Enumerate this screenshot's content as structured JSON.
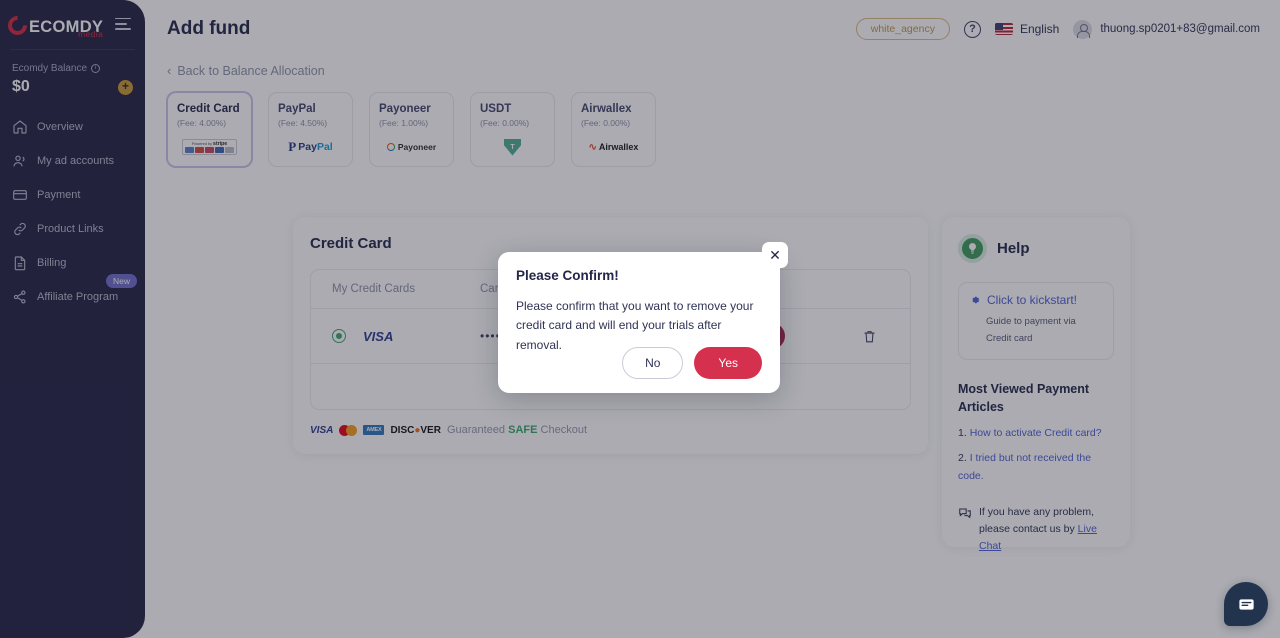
{
  "sidebar": {
    "logo_word": "ECOMDY",
    "logo_sub": "media",
    "balance_label": "Ecomdy Balance",
    "balance_amount": "$0",
    "add_funds_symbol": "+",
    "items": [
      {
        "label": "Overview",
        "icon": "home-icon"
      },
      {
        "label": "My ad accounts",
        "icon": "users-icon"
      },
      {
        "label": "Payment",
        "icon": "credit-card-icon"
      },
      {
        "label": "Product Links",
        "icon": "link-icon"
      },
      {
        "label": "Billing",
        "icon": "document-icon"
      },
      {
        "label": "Affiliate Program",
        "icon": "share-icon",
        "badge": "New"
      }
    ]
  },
  "header": {
    "title": "Add fund",
    "agency_label": "white_agency",
    "help_icon": "question-mark-icon",
    "language": "English",
    "flag": "us-flag-icon",
    "user_email": "thuong.sp0201+83@gmail.com"
  },
  "back_link": {
    "label": "Back to Balance Allocation",
    "icon": "chevron-left-icon"
  },
  "payment_methods": [
    {
      "name": "Credit Card",
      "fee": "(Fee: 4.00%)",
      "logo": "stripe-logo",
      "active": true
    },
    {
      "name": "PayPal",
      "fee": "(Fee: 4.50%)",
      "logo": "paypal-logo",
      "active": false
    },
    {
      "name": "Payoneer",
      "fee": "(Fee: 1.00%)",
      "logo": "payoneer-logo",
      "active": false
    },
    {
      "name": "USDT",
      "fee": "(Fee: 0.00%)",
      "logo": "tether-logo",
      "active": false
    },
    {
      "name": "Airwallex",
      "fee": "(Fee: 0.00%)",
      "logo": "airwallex-logo",
      "active": false
    }
  ],
  "stripe_badge": {
    "powered": "Powered by",
    "brand": "stripe"
  },
  "credit_card_panel": {
    "title": "Credit Card",
    "columns": [
      "My Credit Cards",
      "Card Number",
      "",
      ""
    ],
    "rows": [
      {
        "selected": true,
        "brand": "VISA",
        "masked_number": "••••",
        "action_label": "Set as default",
        "delete_icon": "trash-icon"
      }
    ],
    "add_card_label": "Add credit card",
    "add_card_icon": "plus-icon",
    "secure_text_pre": "Guaranteed",
    "secure_text_safe": "SAFE",
    "secure_text_post": "Checkout",
    "card_brands": [
      "VISA",
      "MasterCard",
      "AMEX",
      "DISCOVER"
    ]
  },
  "help_panel": {
    "title": "Help",
    "bulb_icon": "lightbulb-icon",
    "kickstart_link": "Click to kickstart!",
    "kickstart_icon": "gear-icon",
    "kickstart_sub": "Guide to payment via Credit card",
    "articles_title": "Most Viewed Payment Articles",
    "articles": [
      {
        "num": "1.",
        "text": "How to activate Credit card?"
      },
      {
        "num": "2.",
        "text": "I tried but not received the code."
      }
    ],
    "contact_icon": "chat-icon",
    "contact_text": "If you have any problem, please contact us by",
    "contact_link": "Live Chat"
  },
  "modal": {
    "title": "Please Confirm!",
    "body": "Please confirm that you want to remove your credit card and will end your trials after removal.",
    "close_icon": "close-icon",
    "no_label": "No",
    "yes_label": "Yes"
  },
  "chat_fab": {
    "icon": "message-icon"
  },
  "colors": {
    "sidebar_bg": "#222244",
    "brand_red": "#d6283f",
    "accent_gold": "#c99a36",
    "danger": "#d6304f",
    "link_blue": "#4c5fd7",
    "green": "#3aa76d",
    "badge_purple": "#6e6ccb"
  }
}
